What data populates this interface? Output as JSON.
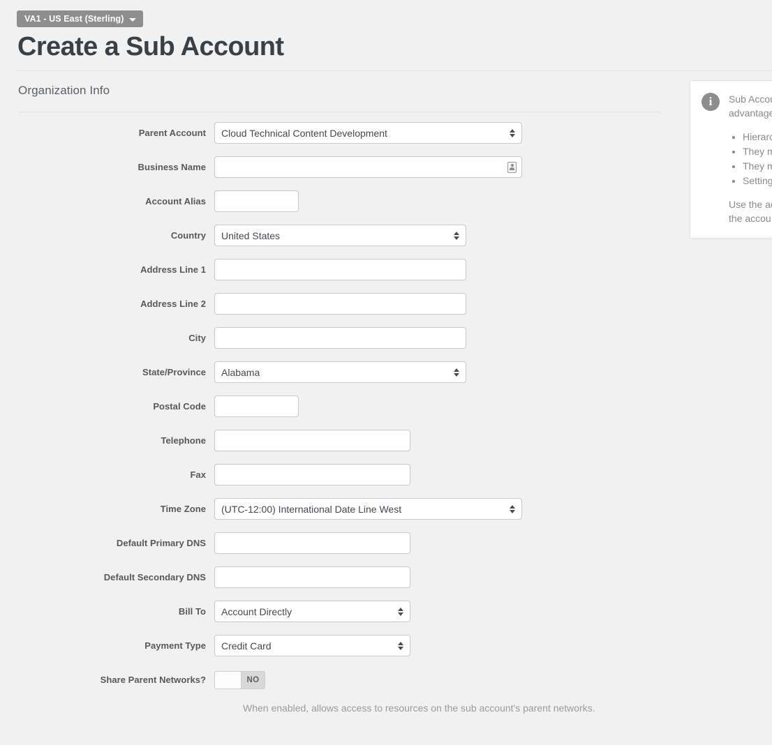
{
  "header": {
    "region_badge": "VA1 - US East (Sterling)",
    "region_caret_icon": "chevron-down-icon",
    "page_title": "Create a Sub Account"
  },
  "section": {
    "title": "Organization Info"
  },
  "form": {
    "parent_account": {
      "label": "Parent Account",
      "value": "Cloud Technical Content Development"
    },
    "business_name": {
      "label": "Business Name",
      "value": "",
      "placeholder": "",
      "autofill_icon": "contact-card-icon"
    },
    "account_alias": {
      "label": "Account Alias",
      "value": "",
      "placeholder": ""
    },
    "country": {
      "label": "Country",
      "value": "United States"
    },
    "address_line_1": {
      "label": "Address Line 1",
      "value": "",
      "placeholder": ""
    },
    "address_line_2": {
      "label": "Address Line 2",
      "value": "",
      "placeholder": ""
    },
    "city": {
      "label": "City",
      "value": "",
      "placeholder": ""
    },
    "state_province": {
      "label": "State/Province",
      "value": "Alabama"
    },
    "postal_code": {
      "label": "Postal Code",
      "value": "",
      "placeholder": ""
    },
    "telephone": {
      "label": "Telephone",
      "value": "",
      "placeholder": ""
    },
    "fax": {
      "label": "Fax",
      "value": "",
      "placeholder": ""
    },
    "time_zone": {
      "label": "Time Zone",
      "value": "(UTC-12:00) International Date Line West"
    },
    "default_primary_dns": {
      "label": "Default Primary DNS",
      "value": "",
      "placeholder": ""
    },
    "default_secondary_dns": {
      "label": "Default Secondary DNS",
      "value": "",
      "placeholder": ""
    },
    "bill_to": {
      "label": "Bill To",
      "value": "Account Directly"
    },
    "payment_type": {
      "label": "Payment Type",
      "value": "Credit Card"
    },
    "share_parent_networks": {
      "label": "Share Parent Networks?",
      "state": "NO",
      "help": "When enabled, allows access to resources on the sub account's parent networks."
    }
  },
  "info_panel": {
    "icon": "info-icon",
    "intro": "Sub Accou… data may … respective… advantage…",
    "bullets": [
      "Hierarchy… sideways.",
      "They may…",
      "They may…",
      "Settings a…"
    ],
    "tail": "Use the ac… all accoun… context. (… the accou…"
  },
  "colors": {
    "page_bg": "#f1f1f1",
    "badge_bg": "#8e8e8e",
    "title": "#3b4045",
    "label": "#57585a",
    "field_border": "#c8c8c8",
    "help_text": "#9b9b9b",
    "info_text": "#8a8a8a"
  }
}
